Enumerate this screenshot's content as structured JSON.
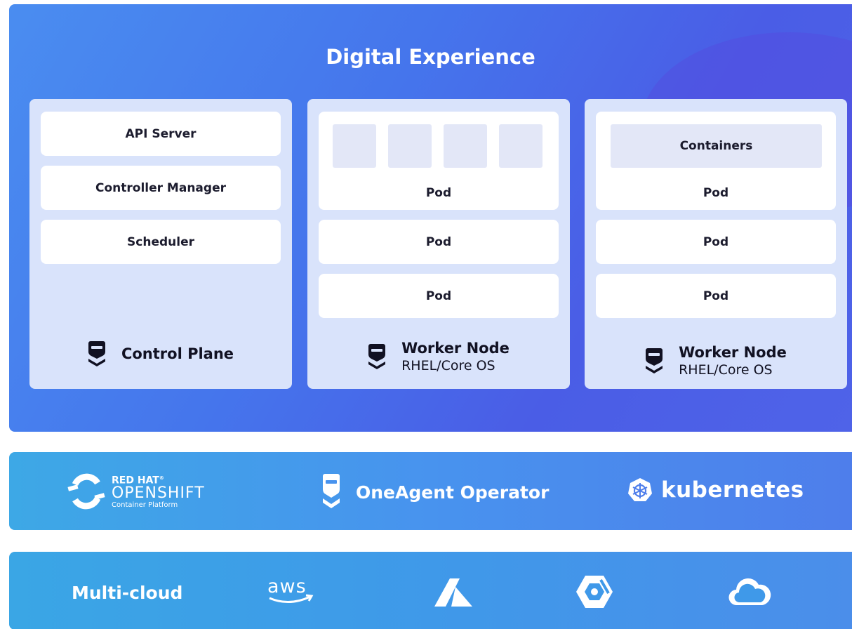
{
  "title": "Digital Experience",
  "control_plane": {
    "components": [
      "API Server",
      "Controller Manager",
      "Scheduler"
    ],
    "label": "Control Plane"
  },
  "worker_nodes": [
    {
      "pods": [
        "Pod",
        "Pod",
        "Pod"
      ],
      "label": "Worker Node",
      "os": "RHEL/Core OS"
    },
    {
      "containers_label": "Containers",
      "pods": [
        "Pod",
        "Pod",
        "Pod"
      ],
      "label": "Worker Node",
      "os": "RHEL/Core OS"
    }
  ],
  "platform_band": {
    "openshift": {
      "line1": "RED HAT",
      "trademark": "®",
      "line2": "OPENSHIFT",
      "line3": "Container Platform"
    },
    "operator_label": "OneAgent Operator",
    "kubernetes_label": "kubernetes"
  },
  "cloud_band": {
    "label": "Multi-cloud",
    "providers": [
      "aws",
      "azure",
      "google-cloud",
      "cloud"
    ]
  },
  "colors": {
    "panel": "#4a6ae8",
    "card": "#d9e3fb",
    "box": "#ffffff",
    "mini": "#e3e7f7",
    "band": "#3da8e6"
  }
}
